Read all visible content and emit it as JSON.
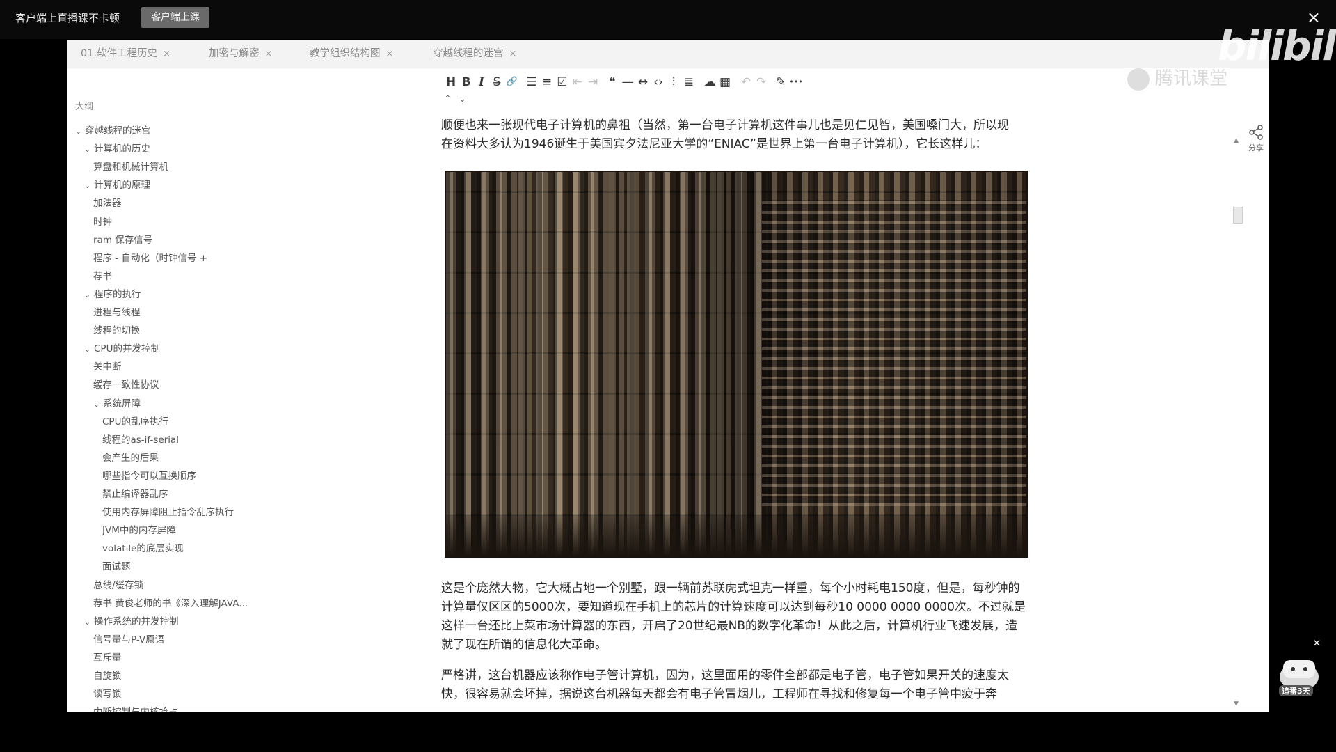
{
  "topbar": {
    "promo_text": "客户端上直播课不卡顿",
    "cta_label": "客户端上课",
    "close_icon": "×"
  },
  "tabs": [
    {
      "label": "01.软件工程历史"
    },
    {
      "label": "加密与解密"
    },
    {
      "label": "教学组织结构图"
    },
    {
      "label": "穿越线程的迷宫"
    }
  ],
  "outline": {
    "heading": "大纲",
    "items": [
      {
        "label": "穿越线程的迷宫",
        "chev": "⌄"
      },
      {
        "label": "计算机的历史",
        "chev": "⌄"
      },
      {
        "label": "算盘和机械计算机",
        "chev": ""
      },
      {
        "label": "计算机的原理",
        "chev": "⌄"
      },
      {
        "label": "加法器",
        "chev": ""
      },
      {
        "label": "时钟",
        "chev": ""
      },
      {
        "label": "ram 保存信号",
        "chev": ""
      },
      {
        "label": "程序 - 自动化（时钟信号 +",
        "chev": ""
      },
      {
        "label": "荐书",
        "chev": ""
      },
      {
        "label": "程序的执行",
        "chev": "⌄"
      },
      {
        "label": "进程与线程",
        "chev": ""
      },
      {
        "label": "线程的切换",
        "chev": ""
      },
      {
        "label": "CPU的并发控制",
        "chev": "⌄"
      },
      {
        "label": "关中断",
        "chev": ""
      },
      {
        "label": "缓存一致性协议",
        "chev": ""
      },
      {
        "label": "系统屏障",
        "chev": "⌄"
      },
      {
        "label": "CPU的乱序执行",
        "chev": ""
      },
      {
        "label": "线程的as-if-serial",
        "chev": ""
      },
      {
        "label": "会产生的后果",
        "chev": ""
      },
      {
        "label": "哪些指令可以互换顺序",
        "chev": ""
      },
      {
        "label": "禁止编译器乱序",
        "chev": ""
      },
      {
        "label": "使用内存屏障阻止指令乱序执行",
        "chev": ""
      },
      {
        "label": "JVM中的内存屏障",
        "chev": ""
      },
      {
        "label": "volatile的底层实现",
        "chev": ""
      },
      {
        "label": "面试题",
        "chev": ""
      },
      {
        "label": "总线/缓存锁",
        "chev": ""
      },
      {
        "label": "荐书 黄俊老师的书《深入理解JAVA...",
        "chev": ""
      },
      {
        "label": "操作系统的并发控制",
        "chev": "⌄"
      },
      {
        "label": "信号量与P-V原语",
        "chev": ""
      },
      {
        "label": "互斥量",
        "chev": ""
      },
      {
        "label": "自旋锁",
        "chev": ""
      },
      {
        "label": "读写锁",
        "chev": ""
      },
      {
        "label": "中断控制与内核抢占",
        "chev": ""
      }
    ]
  },
  "toolbar": {
    "buttons": [
      {
        "name": "heading-icon",
        "glyph": "H"
      },
      {
        "name": "bold-icon",
        "glyph": "B"
      },
      {
        "name": "italic-icon",
        "glyph": "I"
      },
      {
        "name": "strikethrough-icon",
        "glyph": "S̶"
      },
      {
        "name": "link-icon",
        "glyph": "🔗"
      },
      {
        "name": "bullet-list-icon",
        "glyph": "☰"
      },
      {
        "name": "ordered-list-icon",
        "glyph": "≡"
      },
      {
        "name": "task-list-icon",
        "glyph": "☑"
      },
      {
        "name": "outdent-icon",
        "glyph": "⇤"
      },
      {
        "name": "indent-icon",
        "glyph": "⇥"
      },
      {
        "name": "quote-icon",
        "glyph": "❝"
      },
      {
        "name": "horizontal-rule-icon",
        "glyph": "—"
      },
      {
        "name": "code-inline-icon",
        "glyph": "↔"
      },
      {
        "name": "code-block-icon",
        "glyph": "‹›"
      },
      {
        "name": "align-icon",
        "glyph": "⫶"
      },
      {
        "name": "format-icon",
        "glyph": "≣"
      },
      {
        "name": "upload-cloud-icon",
        "glyph": "☁"
      },
      {
        "name": "table-icon",
        "glyph": "▦"
      },
      {
        "name": "undo-icon",
        "glyph": "↶"
      },
      {
        "name": "redo-icon",
        "glyph": "↷"
      },
      {
        "name": "pencil-icon",
        "glyph": "✎"
      },
      {
        "name": "more-icon",
        "glyph": "•••"
      }
    ]
  },
  "doc": {
    "para1_line1": "顺便也来一张现代电子计算机的鼻祖（当然，第一台电子计算机这件事儿也是见仁见智，美国嗓门大，所以现",
    "para1_line2": "在资料大多认为1946诞生于美国宾夕法尼亚大学的“ENIAC”是世界上第一台电子计算机），它长这样儿：",
    "para2_line1": "这是个庞然大物，它大概占地一个别墅，跟一辆前苏联虎式坦克一样重，每个小时耗电150度，但是，每秒钟的",
    "para2_line2": "计算量仅区区的5000次，要知道现在手机上的芯片的计算速度可以达到每秒10 0000 0000 0000次。不过就是",
    "para2_line3": "这样一台还比上菜市场计算器的东西，开启了20世纪最NB的数字化革命！从此之后，计算机行业飞速发展，造",
    "para2_line4": "就了现在所谓的信息化大革命。",
    "para3_line1": "严格讲，这台机器应该称作电子管计算机，因为，这里面用的零件全部都是电子管，电子管如果开关的速度太",
    "para3_line2": "快，很容易就会坏掉，据说这台机器每天都会有电子管冒烟儿，工程师在寻找和修复每一个电子管中疲于奔"
  },
  "rail": {
    "share_label": "分享"
  },
  "watermark": {
    "bili": "bilibili",
    "brand": "腾讯课堂",
    "mascot_label": "追番3天"
  }
}
